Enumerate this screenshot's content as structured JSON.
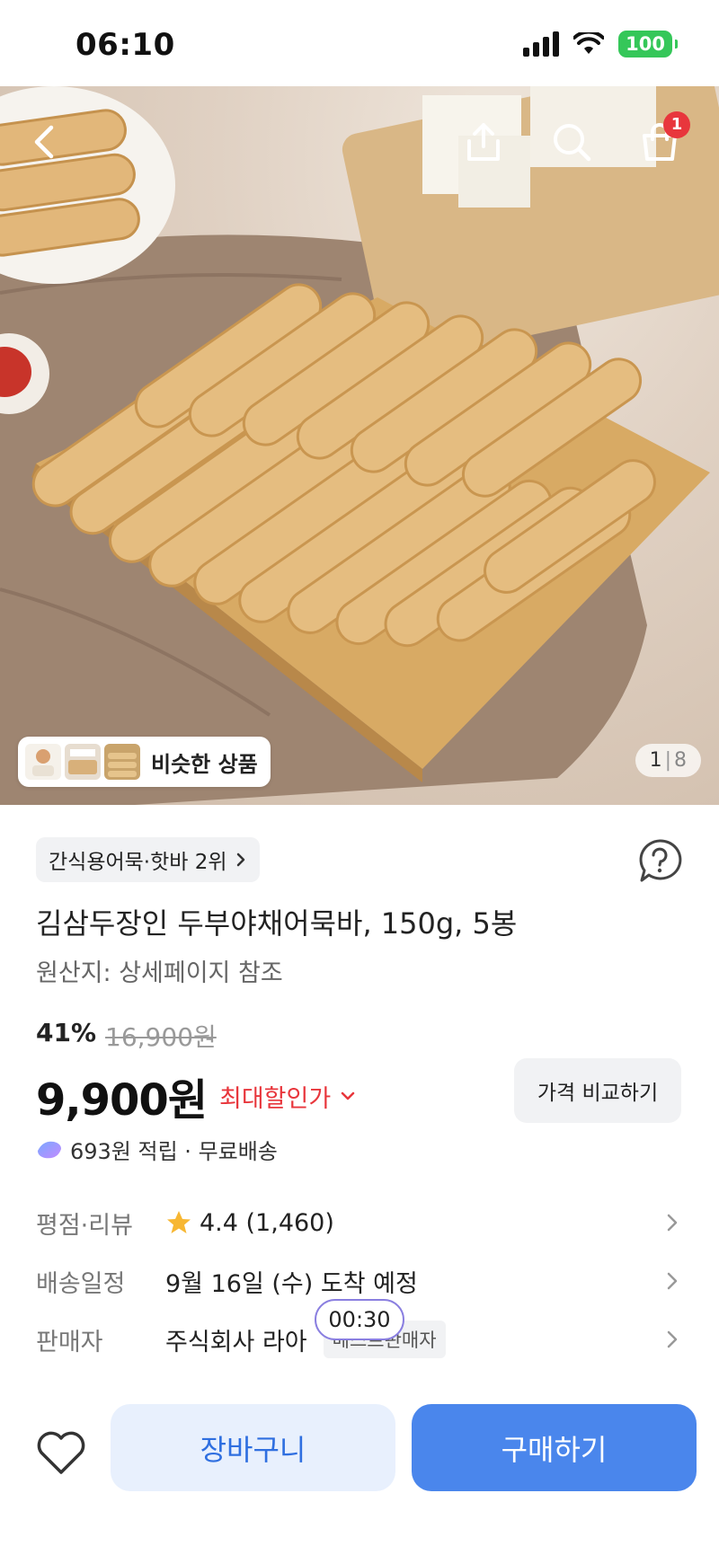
{
  "status_bar": {
    "time": "06:10",
    "battery": "100"
  },
  "hero": {
    "cart_count": "1",
    "similar_label": "비슷한 상품",
    "page_current": "1",
    "page_total": "8"
  },
  "product": {
    "rank": "간식용어묵·핫바 2위",
    "title": "김삼두장인 두부야채어묵바, 150g, 5봉",
    "origin": "원산지: 상세페이지 참조",
    "discount_rate": "41%",
    "original_price": "16,900원",
    "price": "9,900원",
    "max_discount_label": "최대할인가",
    "compare_label": "가격 비교하기",
    "points": "693원 적립 · 무료배송"
  },
  "details": {
    "rating_label": "평점·리뷰",
    "rating_value": "4.4 (1,460)",
    "delivery_label": "배송일정",
    "delivery_value": "9월 16일 (수) 도착 예정",
    "seller_label": "판매자",
    "seller_value": "주식회사 라아",
    "seller_badge": "베스트판매자"
  },
  "timer": "00:30",
  "actions": {
    "cart_label": "장바구니",
    "buy_label": "구매하기"
  },
  "colors": {
    "accent": "#4a86ec",
    "sale": "#e8363c",
    "star": "#f7b733"
  },
  "icons": [
    "back-icon",
    "share-icon",
    "search-icon",
    "cart-icon",
    "question-chat-icon",
    "star-icon",
    "chevron-right-icon",
    "heart-icon",
    "points-icon"
  ]
}
